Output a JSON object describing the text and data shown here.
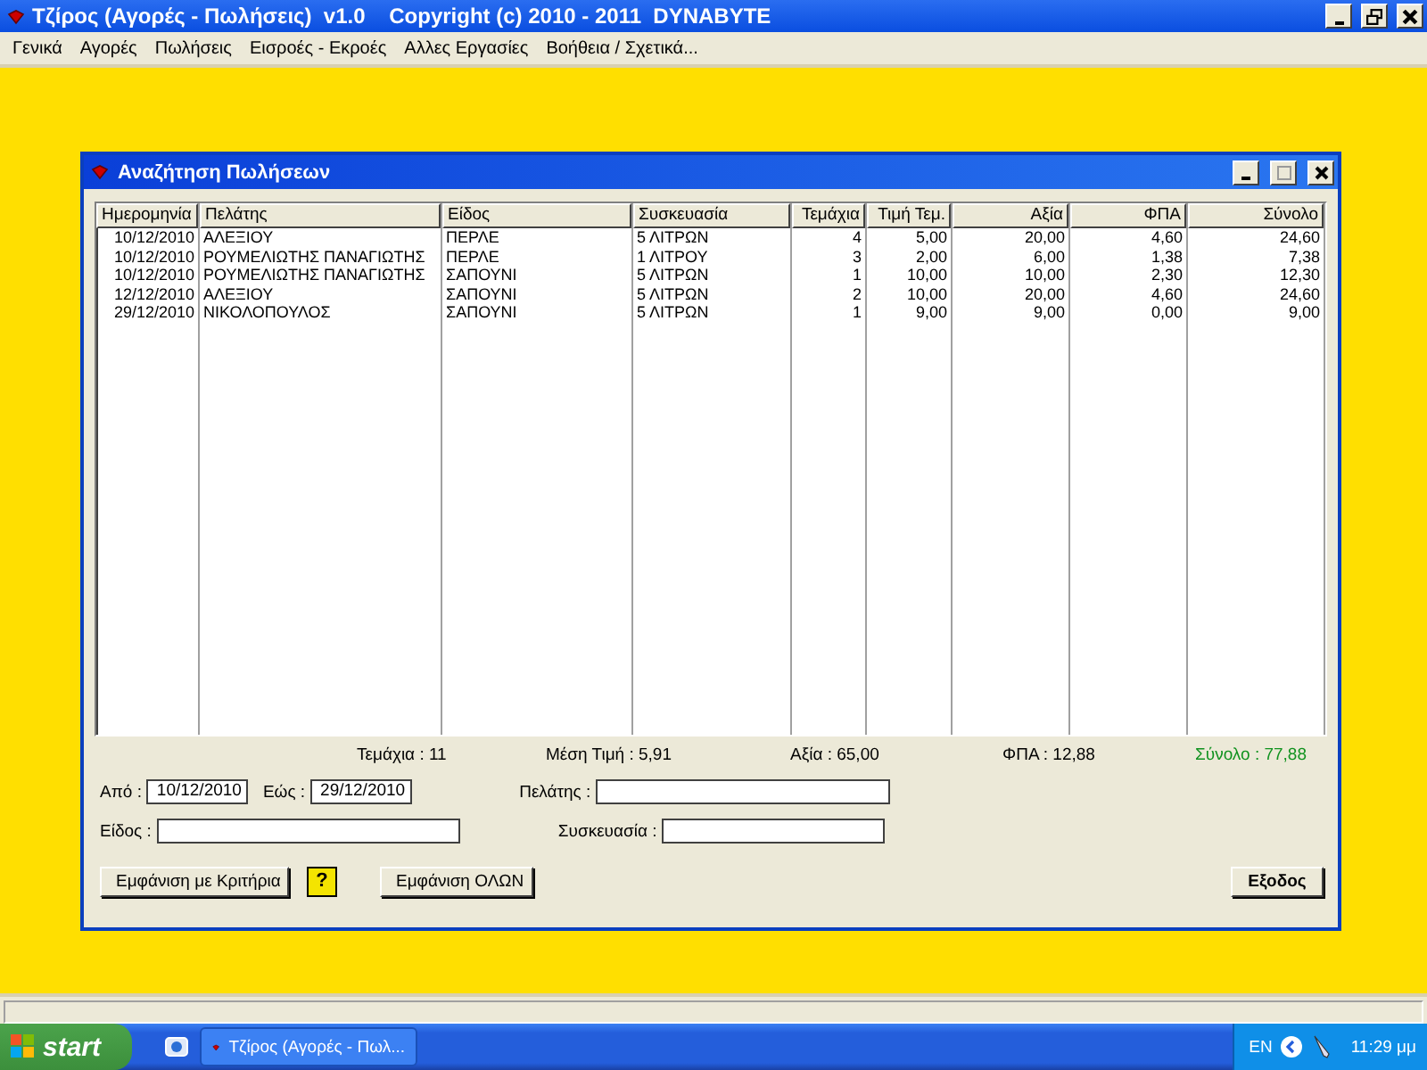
{
  "window": {
    "title": "Τζίρος (Αγορές - Πωλήσεις)  v1.0    Copyright (c) 2010 - 2011  DYNABYTE"
  },
  "menu": [
    "Γενικά",
    "Αγορές",
    "Πωλήσεις",
    "Εισροές - Εκροές",
    "Αλλες Εργασίες",
    "Βοήθεια / Σχετικά..."
  ],
  "dialog": {
    "title": "Αναζήτηση Πωλήσεων",
    "table": {
      "columns": [
        {
          "label": "Ημερομηνία",
          "kind": "date"
        },
        {
          "label": "Πελάτης",
          "kind": "text"
        },
        {
          "label": "Είδος",
          "kind": "text"
        },
        {
          "label": "Συσκευασία",
          "kind": "text"
        },
        {
          "label": "Τεμάχια",
          "kind": "number"
        },
        {
          "label": "Τιμή Τεμ.",
          "kind": "number"
        },
        {
          "label": "Αξία",
          "kind": "number"
        },
        {
          "label": "ΦΠΑ",
          "kind": "number"
        },
        {
          "label": "Σύνολο",
          "kind": "number"
        }
      ],
      "rows": [
        [
          "10/12/2010",
          "ΑΛΕΞΙΟΥ",
          "ΠΕΡΛΕ",
          "5 ΛΙΤΡΩΝ",
          "4",
          "5,00",
          "20,00",
          "4,60",
          "24,60"
        ],
        [
          "10/12/2010",
          "ΡΟΥΜΕΛΙΩΤΗΣ ΠΑΝΑΓΙΩΤΗΣ",
          "ΠΕΡΛΕ",
          "1 ΛΙΤΡΟΥ",
          "3",
          "2,00",
          "6,00",
          "1,38",
          "7,38"
        ],
        [
          "10/12/2010",
          "ΡΟΥΜΕΛΙΩΤΗΣ ΠΑΝΑΓΙΩΤΗΣ",
          "ΣΑΠΟΥΝΙ",
          "5 ΛΙΤΡΩΝ",
          "1",
          "10,00",
          "10,00",
          "2,30",
          "12,30"
        ],
        [
          "12/12/2010",
          "ΑΛΕΞΙΟΥ",
          "ΣΑΠΟΥΝΙ",
          "5 ΛΙΤΡΩΝ",
          "2",
          "10,00",
          "20,00",
          "4,60",
          "24,60"
        ],
        [
          "29/12/2010",
          "ΝΙΚΟΛΟΠΟΥΛΟΣ",
          "ΣΑΠΟΥΝΙ",
          "5 ΛΙΤΡΩΝ",
          "1",
          "9,00",
          "9,00",
          "0,00",
          "9,00"
        ]
      ]
    },
    "totals": [
      {
        "text": "Τεμάχια : 11",
        "kind": "plain"
      },
      {
        "text": "Μέση Τιμή : 5,91",
        "kind": "plain"
      },
      {
        "text": "Αξία : 65,00",
        "kind": "plain"
      },
      {
        "text": "ΦΠΑ : 12,88",
        "kind": "plain"
      },
      {
        "text": "Σύνολο : 77,88",
        "kind": "grand"
      }
    ],
    "filters": {
      "from": {
        "label": "Από :",
        "value": "10/12/2010"
      },
      "to": {
        "label": "Εώς :",
        "value": "29/12/2010"
      },
      "customer": {
        "label": "Πελάτης :"
      },
      "item": {
        "label": "Είδος :"
      },
      "package": {
        "label": "Συσκευασία :"
      }
    },
    "buttons": {
      "criteria": "Εμφάνιση με Κριτήρια",
      "help": "?",
      "all": "Εμφάνιση ΟΛΩΝ",
      "exit": "Εξοδος"
    }
  },
  "taskbar": {
    "start": "start",
    "task": "Τζίρος (Αγορές - Πωλ...",
    "language": "EN",
    "clock": "11:29 μμ"
  }
}
